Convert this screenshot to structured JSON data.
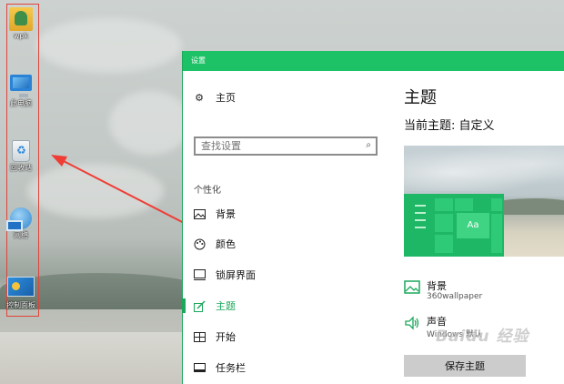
{
  "desktop": {
    "icons": [
      {
        "label": "wpk",
        "icon": "user-folder-icon"
      },
      {
        "label": "此电脑",
        "icon": "this-pc-icon"
      },
      {
        "label": "回收站",
        "icon": "recycle-bin-icon"
      },
      {
        "label": "网络",
        "icon": "network-icon"
      },
      {
        "label": "控制面板",
        "icon": "control-panel-icon"
      }
    ]
  },
  "window": {
    "title": "设置",
    "accent": "#1ec266"
  },
  "nav": {
    "home": "主页",
    "search_placeholder": "查找设置",
    "section": "个性化",
    "items": [
      {
        "label": "背景",
        "icon": "picture-icon"
      },
      {
        "label": "颜色",
        "icon": "palette-icon"
      },
      {
        "label": "锁屏界面",
        "icon": "lock-screen-icon"
      },
      {
        "label": "主题",
        "icon": "brush-icon",
        "active": true
      },
      {
        "label": "开始",
        "icon": "start-grid-icon"
      },
      {
        "label": "任务栏",
        "icon": "taskbar-icon"
      }
    ]
  },
  "content": {
    "title": "主题",
    "current_theme": "当前主题: 自定义",
    "preview_tile": "Aa",
    "options": [
      {
        "name": "背景",
        "value": "360wallpaper",
        "icon": "picture-icon"
      },
      {
        "name": "声音",
        "value": "Windows 默认",
        "icon": "speaker-icon"
      }
    ],
    "save_button": "保存主题"
  },
  "watermark": "Baidu 经验"
}
